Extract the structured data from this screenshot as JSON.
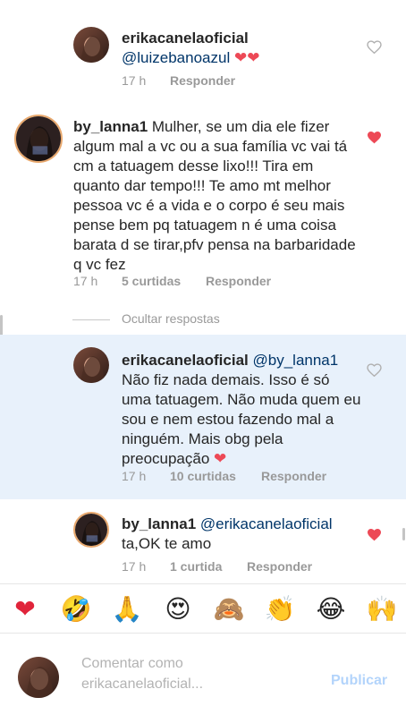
{
  "comments": [
    {
      "username": "erikacanelaoficial",
      "mention": "@luizebanoazul",
      "text": "",
      "emoji_suffix": "❤❤",
      "time": "17 h",
      "likes": "",
      "reply": "Responder",
      "liked": false
    },
    {
      "username": "by_lanna1",
      "mention": "",
      "text": "Mulher, se um dia ele fizer algum mal a vc ou a sua família vc vai tá cm a tatuagem desse lixo!!! Tira em quanto dar tempo!!! Te amo mt melhor pessoa vc é a vida e o corpo é seu mais pense bem pq tatuagem n é uma coisa barata d se tirar,pfv pensa na barbaridade q vc fez",
      "emoji_suffix": "",
      "time": "17 h",
      "likes": "5 curtidas",
      "reply": "Responder",
      "liked": true
    },
    {
      "username": "erikacanelaoficial",
      "mention": "@by_lanna1",
      "text": "Não fiz nada demais. Isso é só uma tatuagem. Não muda quem eu sou e nem estou fazendo mal a ninguém. Mais obg pela preocupação",
      "emoji_suffix": "❤",
      "time": "17 h",
      "likes": "10 curtidas",
      "reply": "Responder",
      "liked": false
    },
    {
      "username": "by_lanna1",
      "mention": "@erikacanelaoficial",
      "text": "ta,OK te amo",
      "emoji_suffix": "",
      "time": "17 h",
      "likes": "1 curtida",
      "reply": "Responder",
      "liked": true
    }
  ],
  "hide_replies": "Ocultar respostas",
  "emojis": [
    {
      "name": "red-heart-emoji",
      "glyph": "❤"
    },
    {
      "name": "laughing-emoji",
      "glyph": "🤣"
    },
    {
      "name": "praying-hands-emoji",
      "glyph": "🙏"
    },
    {
      "name": "heart-eyes-emoji",
      "glyph": "😍"
    },
    {
      "name": "see-no-evil-monkey-emoji",
      "glyph": "🙈"
    },
    {
      "name": "clapping-hands-emoji",
      "glyph": "👏"
    },
    {
      "name": "tears-of-joy-emoji",
      "glyph": "😂"
    },
    {
      "name": "raised-hands-emoji",
      "glyph": "🙌"
    }
  ],
  "composer": {
    "placeholder": "Comentar como erikacanelaoficial...",
    "placeholder_line1": "Comentar como",
    "placeholder_line2": "erikacanelaoficial...",
    "publish": "Publicar"
  },
  "colors": {
    "liked_heart": "#ed4956",
    "link": "#003569",
    "highlight": "#e8f1fb",
    "meta_gray": "#999999",
    "publish_disabled": "#b3d4fb"
  }
}
